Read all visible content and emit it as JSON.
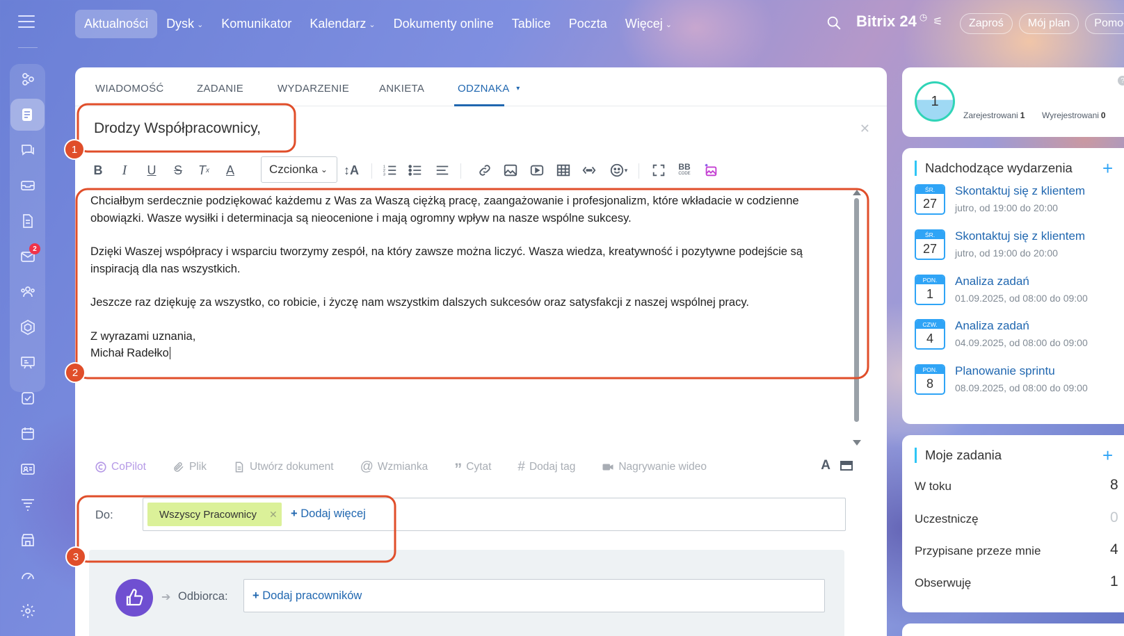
{
  "nav": {
    "items": [
      {
        "label": "Aktualności",
        "active": true,
        "dropdown": false
      },
      {
        "label": "Dysk",
        "active": false,
        "dropdown": true
      },
      {
        "label": "Komunikator",
        "active": false,
        "dropdown": false
      },
      {
        "label": "Kalendarz",
        "active": false,
        "dropdown": true
      },
      {
        "label": "Dokumenty online",
        "active": false,
        "dropdown": false
      },
      {
        "label": "Tablice",
        "active": false,
        "dropdown": false
      },
      {
        "label": "Poczta",
        "active": false,
        "dropdown": false
      },
      {
        "label": "Więcej",
        "active": false,
        "dropdown": true
      }
    ],
    "brand": "Bitrix 24",
    "buttons": [
      "Zaproś",
      "Mój plan",
      "Pomoc"
    ]
  },
  "sidebar": {
    "mail_badge": "2",
    "icons": [
      "tasks-flow-icon",
      "news-feed-icon",
      "chat-icon",
      "inbox-tray-icon",
      "document-icon",
      "mail-icon",
      "employees-icon",
      "hexagon-icon",
      "presentation-icon",
      "checkbox-icon",
      "calendar-icon",
      "contact-card-icon",
      "filter-funnel-icon",
      "store-icon",
      "speedometer-icon",
      "settings-gear-icon"
    ]
  },
  "composer": {
    "tabs": [
      "WIADOMOŚĆ",
      "ZADANIE",
      "WYDARZENIE",
      "ANKIETA",
      "ODZNAKA"
    ],
    "active_tab": "ODZNAKA",
    "title": "Drodzy Współpracownicy,",
    "font_label": "Czcionka",
    "body": [
      "Chciałbym serdecznie podziękować każdemu z Was za Waszą ciężką pracę, zaangażowanie i profesjonalizm, które wkładacie w codzienne obowiązki. Wasze wysiłki i determinacja są nieocenione i mają ogromny wpływ na nasze wspólne sukcesy.",
      "Dzięki Waszej współpracy i wsparciu tworzymy zespół, na który zawsze można liczyć. Wasza wiedza, kreatywność i pozytywne podejście są inspiracją dla nas wszystkich.",
      "Jeszcze raz dziękuję za wszystko, co robicie, i życzę nam wszystkim dalszych sukcesów oraz satysfakcji z naszej wspólnej pracy."
    ],
    "closing_1": "Z wyrazami uznania,",
    "closing_2": "Michał Radełko",
    "actions": [
      "CoPilot",
      "Plik",
      "Utwórz dokument",
      "Wzmianka",
      "Cytat",
      "Dodaj tag",
      "Nagrywanie wideo"
    ],
    "to_label": "Do:",
    "to_chip": "Wszyscy Pracownicy",
    "add_more": "Dodaj więcej",
    "recipient_label": "Odbiorca:",
    "add_employees": "Dodaj pracowników"
  },
  "annotations": [
    "1",
    "2",
    "3"
  ],
  "stats": {
    "count": "1",
    "registered_label": "Zarejestrowani",
    "registered_value": "1",
    "unregistered_label": "Wyrejestrowani",
    "unregistered_value": "0"
  },
  "events": {
    "title": "Nadchodzące wydarzenia",
    "items": [
      {
        "month": "ŚR.",
        "day": "27",
        "title": "Skontaktuj się z klientem",
        "time": "jutro, od 19:00 do 20:00"
      },
      {
        "month": "ŚR.",
        "day": "27",
        "title": "Skontaktuj się z klientem",
        "time": "jutro, od 19:00 do 20:00"
      },
      {
        "month": "PON.",
        "day": "1",
        "title": "Analiza zadań",
        "time": "01.09.2025, od 08:00 do 09:00"
      },
      {
        "month": "CZW.",
        "day": "4",
        "title": "Analiza zadań",
        "time": "04.09.2025, od 08:00 do 09:00"
      },
      {
        "month": "PON.",
        "day": "8",
        "title": "Planowanie sprintu",
        "time": "08.09.2025, od 08:00 do 09:00"
      }
    ]
  },
  "tasks": {
    "title": "Moje zadania",
    "items": [
      {
        "label": "W toku",
        "count": "8"
      },
      {
        "label": "Uczestniczę",
        "count": "0"
      },
      {
        "label": "Przypisane przeze mnie",
        "count": "4"
      },
      {
        "label": "Obserwuję",
        "count": "1"
      }
    ]
  },
  "colors": {
    "accent_blue": "#2067b0",
    "annotation_red": "#e04e2a",
    "chip_green": "#dbf199",
    "badge_purple": "#6f4fd1"
  }
}
